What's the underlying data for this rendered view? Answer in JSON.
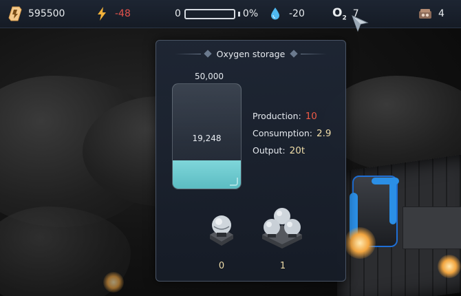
{
  "topbar": {
    "credits": "595500",
    "energy": "-48",
    "battery_left": "0",
    "battery_percent": "0%",
    "battery_level": 0,
    "water": "-20",
    "oxygen_symbol": "O",
    "oxygen_sub": "2",
    "oxygen": "7",
    "workers": "4",
    "icons": [
      "credits-icon",
      "lightning-icon",
      "battery-icon",
      "water-drop-icon",
      "oxygen-icon",
      "workers-icon"
    ]
  },
  "panel": {
    "title": "Oxygen storage",
    "capacity": "50,000",
    "stored": "19,248",
    "fill_fraction": 0.27,
    "stats": [
      {
        "label": "Production:",
        "value": "10",
        "color": "#ee5a46"
      },
      {
        "label": "Consumption:",
        "value": "2.9",
        "color": "#f0deaa"
      },
      {
        "label": "Output:",
        "value": "20t",
        "color": "#f0deaa"
      }
    ],
    "tanks": [
      {
        "name": "single-tank",
        "count": "0"
      },
      {
        "name": "triple-tank",
        "count": "1"
      }
    ]
  },
  "colors": {
    "topbar_bg": "#1a212c",
    "negative": "#e2524c",
    "oxygen_fill": "#6ccbd0",
    "accent_gold": "#f0deaa"
  }
}
